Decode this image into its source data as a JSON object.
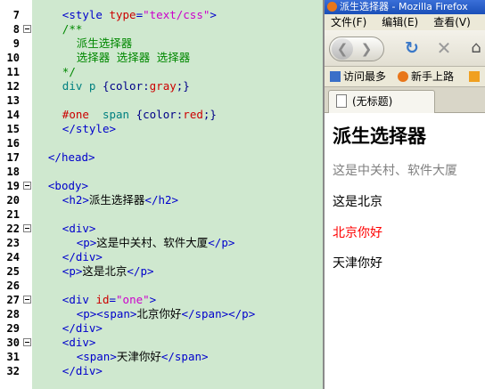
{
  "editor": {
    "lines": [
      {
        "num": "7",
        "fold": false,
        "tokens": [
          {
            "t": "        ",
            "c": "txt"
          },
          {
            "t": "<style ",
            "c": "tag"
          },
          {
            "t": "type",
            "c": "attr"
          },
          {
            "t": "=",
            "c": "tag"
          },
          {
            "t": "\"text/css\"",
            "c": "str"
          },
          {
            "t": ">",
            "c": "tag"
          }
        ]
      },
      {
        "num": "8",
        "fold": true,
        "tokens": [
          {
            "t": "        ",
            "c": "txt"
          },
          {
            "t": "/**",
            "c": "cmt"
          }
        ]
      },
      {
        "num": "9",
        "fold": false,
        "tokens": [
          {
            "t": "            ",
            "c": "txt"
          },
          {
            "t": "派生选择器",
            "c": "cmt"
          }
        ]
      },
      {
        "num": "10",
        "fold": false,
        "tokens": [
          {
            "t": "            ",
            "c": "txt"
          },
          {
            "t": "选择器 选择器 选择器",
            "c": "cmt"
          }
        ]
      },
      {
        "num": "11",
        "fold": false,
        "tokens": [
          {
            "t": "        ",
            "c": "txt"
          },
          {
            "t": "*/",
            "c": "cmt"
          }
        ]
      },
      {
        "num": "12",
        "fold": false,
        "tokens": [
          {
            "t": "        ",
            "c": "txt"
          },
          {
            "t": "div p ",
            "c": "teal"
          },
          {
            "t": "{",
            "c": "prop"
          },
          {
            "t": "color",
            "c": "prop"
          },
          {
            "t": ":",
            "c": "prop"
          },
          {
            "t": "gray",
            "c": "red"
          },
          {
            "t": ";}",
            "c": "prop"
          }
        ]
      },
      {
        "num": "13",
        "fold": false,
        "tokens": []
      },
      {
        "num": "14",
        "fold": false,
        "tokens": [
          {
            "t": "        ",
            "c": "txt"
          },
          {
            "t": "#one  ",
            "c": "red"
          },
          {
            "t": "span ",
            "c": "teal"
          },
          {
            "t": "{",
            "c": "prop"
          },
          {
            "t": "color",
            "c": "prop"
          },
          {
            "t": ":",
            "c": "prop"
          },
          {
            "t": "red",
            "c": "red"
          },
          {
            "t": ";}",
            "c": "prop"
          }
        ]
      },
      {
        "num": "15",
        "fold": false,
        "tokens": [
          {
            "t": "        ",
            "c": "txt"
          },
          {
            "t": "</style>",
            "c": "tag"
          }
        ]
      },
      {
        "num": "16",
        "fold": false,
        "tokens": []
      },
      {
        "num": "17",
        "fold": false,
        "tokens": [
          {
            "t": "    ",
            "c": "txt"
          },
          {
            "t": "</head>",
            "c": "tag"
          }
        ]
      },
      {
        "num": "18",
        "fold": false,
        "tokens": []
      },
      {
        "num": "19",
        "fold": true,
        "tokens": [
          {
            "t": "    ",
            "c": "txt"
          },
          {
            "t": "<body>",
            "c": "tag"
          }
        ]
      },
      {
        "num": "20",
        "fold": false,
        "tokens": [
          {
            "t": "        ",
            "c": "txt"
          },
          {
            "t": "<h2>",
            "c": "tag"
          },
          {
            "t": "派生选择器",
            "c": "txt"
          },
          {
            "t": "</h2>",
            "c": "tag"
          }
        ]
      },
      {
        "num": "21",
        "fold": false,
        "tokens": []
      },
      {
        "num": "22",
        "fold": true,
        "tokens": [
          {
            "t": "        ",
            "c": "txt"
          },
          {
            "t": "<div>",
            "c": "tag"
          }
        ]
      },
      {
        "num": "23",
        "fold": false,
        "tokens": [
          {
            "t": "            ",
            "c": "txt"
          },
          {
            "t": "<p>",
            "c": "tag"
          },
          {
            "t": "这是中关村、软件大厦",
            "c": "txt"
          },
          {
            "t": "</p>",
            "c": "tag"
          }
        ]
      },
      {
        "num": "24",
        "fold": false,
        "tokens": [
          {
            "t": "        ",
            "c": "txt"
          },
          {
            "t": "</div>",
            "c": "tag"
          }
        ]
      },
      {
        "num": "25",
        "fold": false,
        "tokens": [
          {
            "t": "        ",
            "c": "txt"
          },
          {
            "t": "<p>",
            "c": "tag"
          },
          {
            "t": "这是北京",
            "c": "txt"
          },
          {
            "t": "</p>",
            "c": "tag"
          }
        ]
      },
      {
        "num": "26",
        "fold": false,
        "tokens": []
      },
      {
        "num": "27",
        "fold": true,
        "tokens": [
          {
            "t": "        ",
            "c": "txt"
          },
          {
            "t": "<div ",
            "c": "tag"
          },
          {
            "t": "id",
            "c": "attr"
          },
          {
            "t": "=",
            "c": "tag"
          },
          {
            "t": "\"one\"",
            "c": "str"
          },
          {
            "t": ">",
            "c": "tag"
          }
        ]
      },
      {
        "num": "28",
        "fold": false,
        "tokens": [
          {
            "t": "            ",
            "c": "txt"
          },
          {
            "t": "<p><span>",
            "c": "tag"
          },
          {
            "t": "北京你好",
            "c": "txt"
          },
          {
            "t": "</span></p>",
            "c": "tag"
          }
        ]
      },
      {
        "num": "29",
        "fold": false,
        "tokens": [
          {
            "t": "        ",
            "c": "txt"
          },
          {
            "t": "</div>",
            "c": "tag"
          }
        ]
      },
      {
        "num": "30",
        "fold": true,
        "tokens": [
          {
            "t": "        ",
            "c": "txt"
          },
          {
            "t": "<div>",
            "c": "tag"
          }
        ]
      },
      {
        "num": "31",
        "fold": false,
        "tokens": [
          {
            "t": "            ",
            "c": "txt"
          },
          {
            "t": "<span>",
            "c": "tag"
          },
          {
            "t": "天津你好",
            "c": "txt"
          },
          {
            "t": "</span>",
            "c": "tag"
          }
        ]
      },
      {
        "num": "32",
        "fold": false,
        "tokens": [
          {
            "t": "        ",
            "c": "txt"
          },
          {
            "t": "</div>",
            "c": "tag"
          }
        ]
      }
    ]
  },
  "browser": {
    "window_title": "派生选择器 - Mozilla Firefox",
    "menu": [
      "文件(F)",
      "编辑(E)",
      "查看(V)"
    ],
    "bookmarks": [
      {
        "label": "访问最多",
        "icon": "bookmark-folder-icon",
        "color": "#3a6fc8"
      },
      {
        "label": "新手上路",
        "icon": "firefox-icon",
        "color": "#e8761a"
      },
      {
        "label": "",
        "icon": "rss-icon",
        "color": "#f0a020"
      }
    ],
    "tab_label": "(无标题)",
    "content": {
      "heading": "派生选择器",
      "paragraphs": [
        {
          "text": "这是中关村、软件大厦",
          "color": "#808080"
        },
        {
          "text": "这是北京",
          "color": "#000000"
        },
        {
          "text": "北京你好",
          "color": "#ff0000"
        },
        {
          "text": "天津你好",
          "color": "#000000"
        }
      ]
    }
  }
}
